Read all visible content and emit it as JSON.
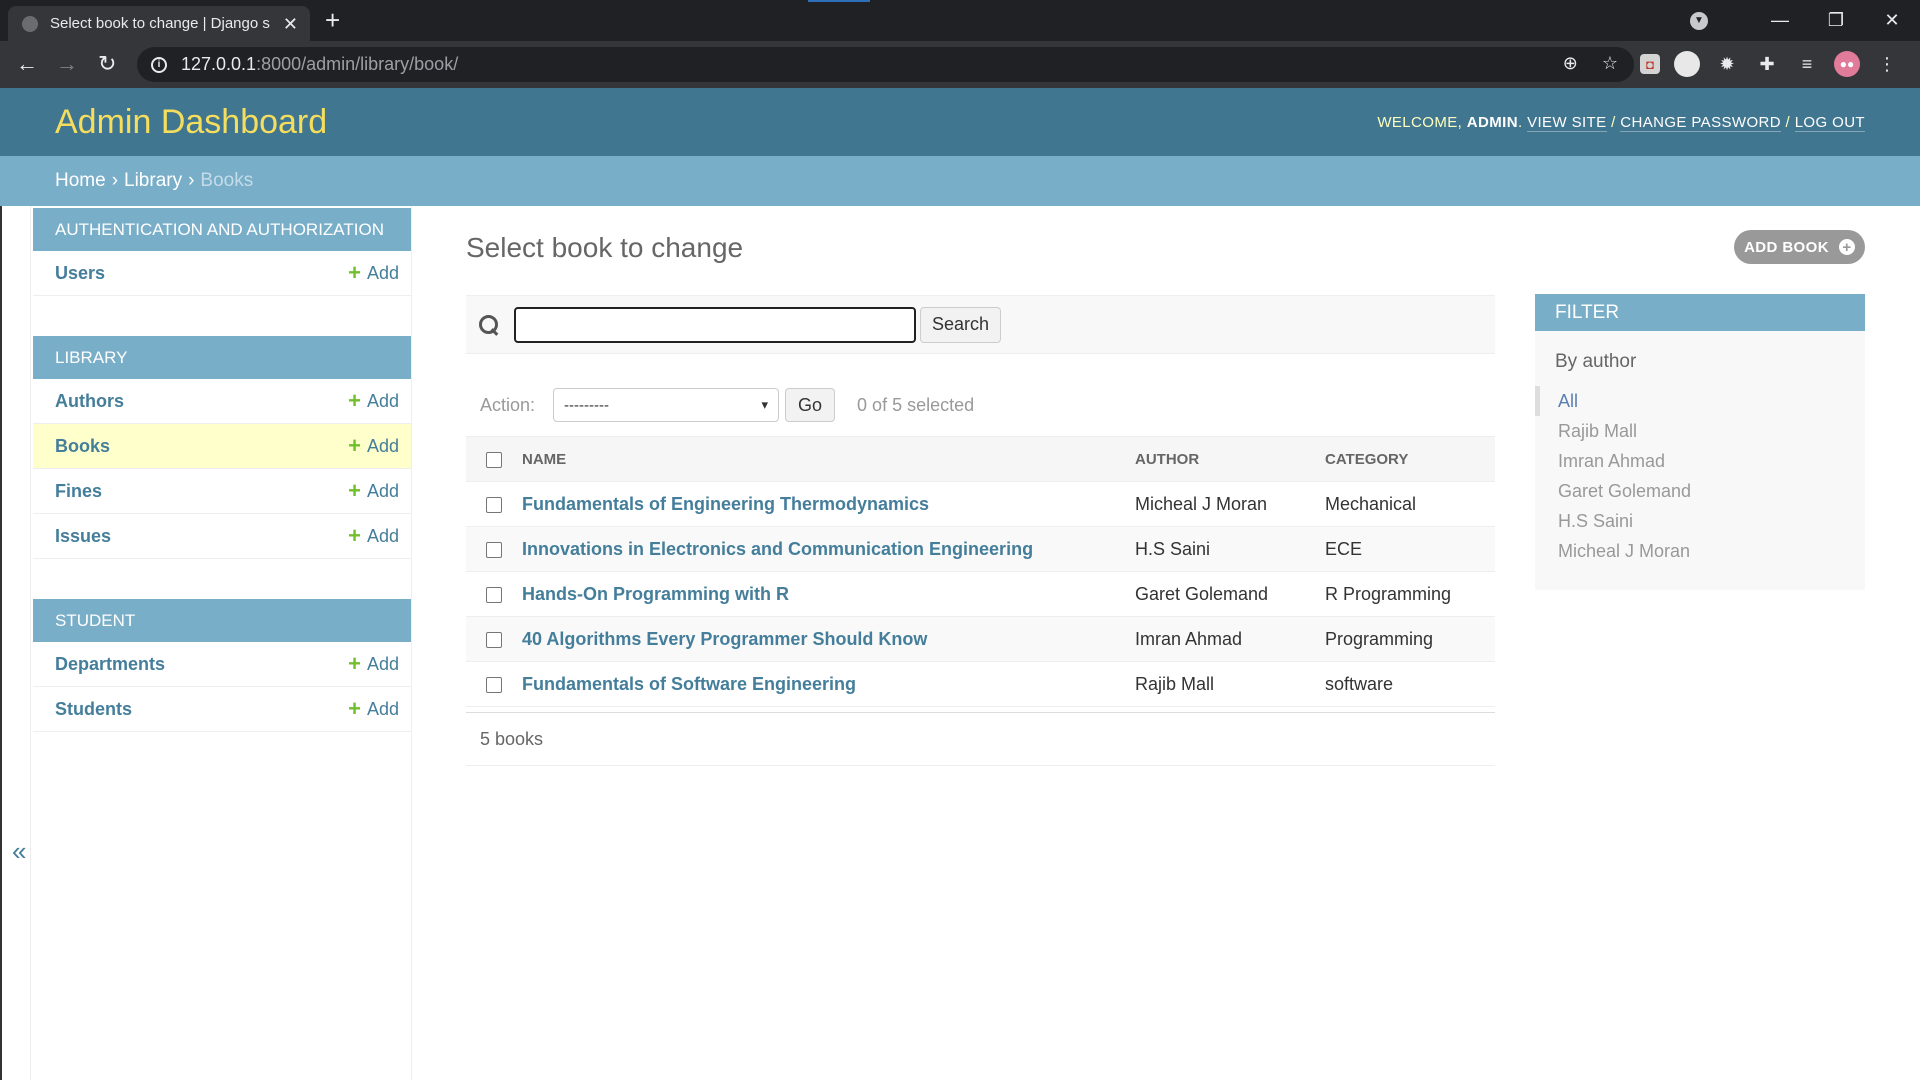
{
  "browser": {
    "tab_title": "Select book to change | Django s",
    "url_host": "127.0.0.1",
    "url_rest": ":8000/admin/library/book/"
  },
  "header": {
    "branding": "Admin Dashboard",
    "welcome": "Welcome,",
    "username": "admin",
    "view_site": "View site",
    "change_password": "Change password",
    "log_out": "Log out"
  },
  "breadcrumbs": {
    "home": "Home",
    "app": "Library",
    "current": "Books"
  },
  "sidebar": {
    "toggle": "«",
    "add_label": "Add",
    "modules": [
      {
        "caption": "Authentication and Authorization",
        "models": [
          "Users"
        ]
      },
      {
        "caption": "Library",
        "models": [
          "Authors",
          "Books",
          "Fines",
          "Issues"
        ]
      },
      {
        "caption": "Student",
        "models": [
          "Departments",
          "Students"
        ]
      }
    ]
  },
  "content": {
    "title": "Select book to change",
    "add_button": "Add book",
    "search": {
      "value": "",
      "button": "Search"
    },
    "actions": {
      "label": "Action:",
      "selected_option": "---------",
      "go": "Go",
      "counter": "0 of 5 selected"
    },
    "table": {
      "headers": [
        "Name",
        "Author",
        "Category"
      ],
      "rows": [
        [
          "Fundamentals of Engineering Thermodynamics",
          "Micheal J Moran",
          "Mechanical"
        ],
        [
          "Innovations in Electronics and Communication Engineering",
          "H.S Saini",
          "ECE"
        ],
        [
          "Hands-On Programming with R",
          "Garet Golemand",
          "R Programming"
        ],
        [
          "40 Algorithms Every Programmer Should Know",
          "Imran Ahmad",
          "Programming"
        ],
        [
          "Fundamentals of Software Engineering",
          "Rajib Mall",
          "software"
        ]
      ]
    },
    "paginator": "5 books"
  },
  "filter": {
    "title": "Filter",
    "subtitle": "By author",
    "options": [
      "All",
      "Rajib Mall",
      "Imran Ahmad",
      "Garet Golemand",
      "H.S Saini",
      "Micheal J Moran"
    ],
    "selected": "All"
  },
  "colors": {
    "header_bg": "#417690",
    "breadcrumbs_bg": "#79aec8",
    "link": "#447e9b",
    "branding": "#f5dd5d",
    "add_green": "#70bf2b",
    "current_row": "#ffffcc"
  }
}
